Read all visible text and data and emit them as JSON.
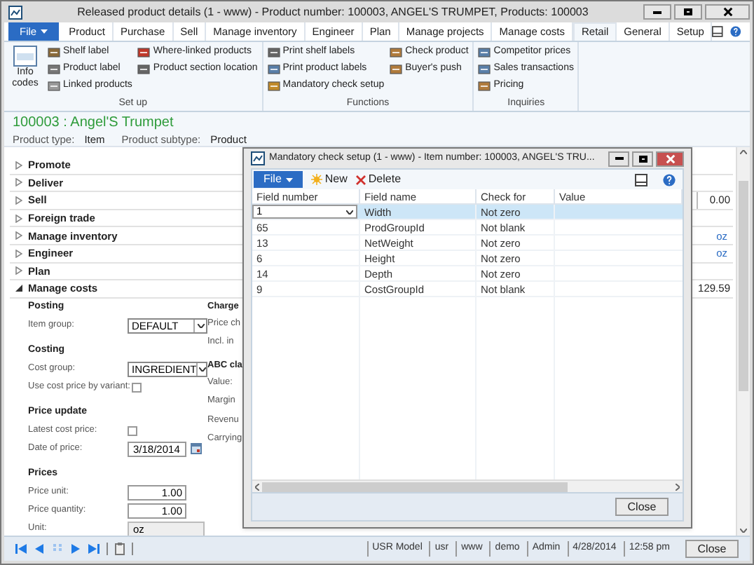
{
  "window": {
    "title": "Released product details (1 - www) - Product number: 100003, ANGEL'S TRUMPET, Products: 100003"
  },
  "tabs": [
    {
      "label": "File",
      "kind": "file",
      "selected": false
    },
    {
      "label": "Product",
      "kind": "tab",
      "selected": false
    },
    {
      "label": "Purchase",
      "kind": "tab",
      "selected": false
    },
    {
      "label": "Sell",
      "kind": "tab",
      "selected": false
    },
    {
      "label": "Manage inventory",
      "kind": "tab",
      "selected": false
    },
    {
      "label": "Engineer",
      "kind": "tab",
      "selected": false
    },
    {
      "label": "Plan",
      "kind": "tab",
      "selected": false
    },
    {
      "label": "Manage projects",
      "kind": "tab",
      "selected": false
    },
    {
      "label": "Manage costs",
      "kind": "tab",
      "selected": false
    },
    {
      "label": "Retail",
      "kind": "tab",
      "selected": true
    },
    {
      "label": "General",
      "kind": "tab",
      "selected": false
    },
    {
      "label": "Setup",
      "kind": "tab",
      "selected": false
    }
  ],
  "ribbon": {
    "groups": [
      {
        "label": "Set up",
        "columns": [
          [
            {
              "label": "Info codes",
              "kind": "large"
            }
          ],
          [
            {
              "label": "Shelf label",
              "kind": "small"
            },
            {
              "label": "Product label",
              "kind": "small"
            },
            {
              "label": "Linked products",
              "kind": "small"
            }
          ],
          [
            {
              "label": "Where-linked products",
              "kind": "small"
            },
            {
              "label": "Product section location",
              "kind": "small"
            }
          ]
        ]
      },
      {
        "label": "Functions",
        "columns": [
          [
            {
              "label": "Print shelf labels",
              "kind": "small"
            },
            {
              "label": "Print product labels",
              "kind": "small"
            },
            {
              "label": "Mandatory check setup",
              "kind": "small"
            }
          ],
          [
            {
              "label": "Check product",
              "kind": "small"
            },
            {
              "label": "Buyer's push",
              "kind": "small"
            }
          ]
        ]
      },
      {
        "label": "Inquiries",
        "columns": [
          [
            {
              "label": "Competitor prices",
              "kind": "small"
            },
            {
              "label": "Sales transactions",
              "kind": "small"
            },
            {
              "label": "Pricing",
              "kind": "small"
            }
          ]
        ]
      }
    ]
  },
  "header": {
    "title": "100003 : Angel'S Trumpet",
    "fields": [
      {
        "label": "Product type:",
        "value": "Item"
      },
      {
        "label": "Product subtype:",
        "value": "Product"
      }
    ]
  },
  "fasttabs": [
    {
      "label": "Promote",
      "expanded": false
    },
    {
      "label": "Deliver",
      "expanded": false
    },
    {
      "label": "Sell",
      "expanded": false,
      "summary": {
        "text": "0.00",
        "kind": "value"
      }
    },
    {
      "label": "Foreign trade",
      "expanded": false
    },
    {
      "label": "Manage inventory",
      "expanded": false,
      "summary": {
        "text": "oz",
        "kind": "link"
      }
    },
    {
      "label": "Engineer",
      "expanded": false,
      "summary": {
        "text": "oz",
        "kind": "link"
      }
    },
    {
      "label": "Plan",
      "expanded": false
    },
    {
      "label": "Manage costs",
      "expanded": true,
      "summary": {
        "text": "129.59",
        "kind": "value"
      },
      "left": [
        {
          "title": "Posting",
          "fields": [
            {
              "label": "Item group:",
              "kind": "combo",
              "value": "DEFAULT"
            }
          ]
        },
        {
          "title": "Costing",
          "fields": [
            {
              "label": "Cost group:",
              "kind": "combo",
              "value": "INGREDIENT"
            },
            {
              "label": "Use cost price by variant:",
              "kind": "checkbox",
              "checked": false
            }
          ]
        },
        {
          "title": "Price update",
          "fields": [
            {
              "label": "Latest cost price:",
              "kind": "checkbox",
              "checked": false
            },
            {
              "label": "Date of price:",
              "kind": "date",
              "value": "3/18/2014"
            }
          ]
        },
        {
          "title": "Prices",
          "fields": [
            {
              "label": "Price unit:",
              "kind": "number",
              "value": "1.00"
            },
            {
              "label": "Price quantity:",
              "kind": "number",
              "value": "1.00"
            },
            {
              "label": "Unit:",
              "kind": "readonly",
              "value": "oz"
            }
          ]
        }
      ],
      "middle": [
        {
          "title": "Charge",
          "fields": [
            "Price ch",
            "Incl. in"
          ]
        },
        {
          "title": "ABC cla",
          "fields": [
            "Value:",
            "Margin",
            "Revenu",
            "Carrying"
          ]
        }
      ]
    }
  ],
  "dialog": {
    "title": "Mandatory check setup (1 - www) - Item number: 100003, ANGEL'S TRU...",
    "toolbar": [
      {
        "label": "File",
        "kind": "file"
      },
      {
        "label": "New",
        "kind": "new"
      },
      {
        "label": "Delete",
        "kind": "delete"
      }
    ],
    "columns": [
      "Field number",
      "Field name",
      "Check for",
      "Value"
    ],
    "rows": [
      {
        "cells": [
          "1",
          "Width",
          "Not zero"
        ],
        "selected": true
      },
      {
        "cells": [
          "65",
          "ProdGroupId",
          "Not blank"
        ],
        "selected": false
      },
      {
        "cells": [
          "13",
          "NetWeight",
          "Not zero"
        ],
        "selected": false
      },
      {
        "cells": [
          "6",
          "Height",
          "Not zero"
        ],
        "selected": false
      },
      {
        "cells": [
          "14",
          "Depth",
          "Not zero"
        ],
        "selected": false
      },
      {
        "cells": [
          "9",
          "CostGroupId",
          "Not blank"
        ],
        "selected": false
      }
    ],
    "close_button": "Close"
  },
  "status_bar": {
    "items": [
      "USR Model",
      "usr",
      "www",
      "demo",
      "Admin",
      "4/28/2014",
      "12:58 pm"
    ],
    "close_button": "Close"
  }
}
